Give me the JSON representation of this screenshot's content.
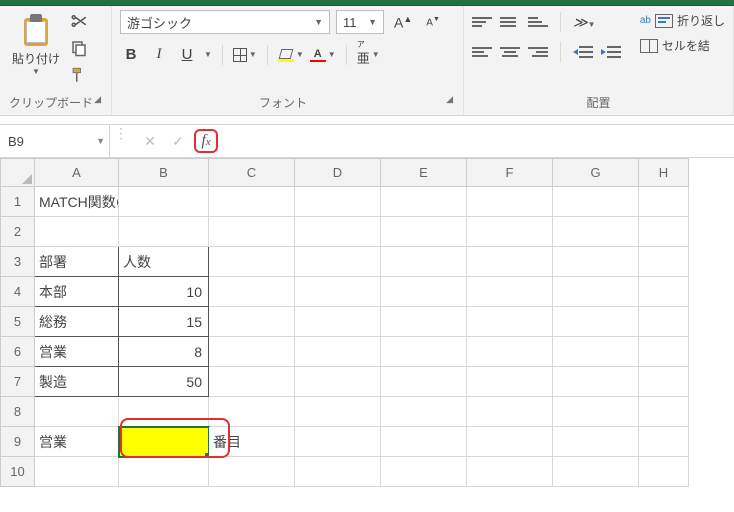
{
  "ribbon": {
    "clipboard": {
      "paste_label": "貼り付け",
      "group_label": "クリップボード"
    },
    "font": {
      "font_name": "游ゴシック",
      "font_size": "11",
      "group_label": "フォント"
    },
    "alignment": {
      "wrap_label": "折り返し",
      "merge_label": "セルを結",
      "group_label": "配置"
    }
  },
  "formula_bar": {
    "name_box": "B9",
    "formula": ""
  },
  "sheet": {
    "columns": [
      "A",
      "B",
      "C",
      "D",
      "E",
      "F",
      "G",
      "H"
    ],
    "rows": [
      "1",
      "2",
      "3",
      "4",
      "5",
      "6",
      "7",
      "8",
      "9",
      "10"
    ],
    "cells": {
      "A1": "MATCH関数の使い方",
      "A3": "部署",
      "B3": "人数",
      "A4": "本部",
      "B4": "10",
      "A5": "総務",
      "B5": "15",
      "A6": "営業",
      "B6": "8",
      "A7": "製造",
      "B7": "50",
      "A9": "営業",
      "B9": "",
      "C9": "番目"
    },
    "selected": "B9",
    "highlight_fill": "#FFFF00"
  },
  "chart_data": {
    "type": "table",
    "title": "MATCH関数の使い方",
    "columns": [
      "部署",
      "人数"
    ],
    "rows": [
      {
        "部署": "本部",
        "人数": 10
      },
      {
        "部署": "総務",
        "人数": 15
      },
      {
        "部署": "営業",
        "人数": 8
      },
      {
        "部署": "製造",
        "人数": 50
      }
    ],
    "lookup": {
      "value": "営業",
      "result_cell": "B9",
      "suffix": "番目"
    }
  }
}
